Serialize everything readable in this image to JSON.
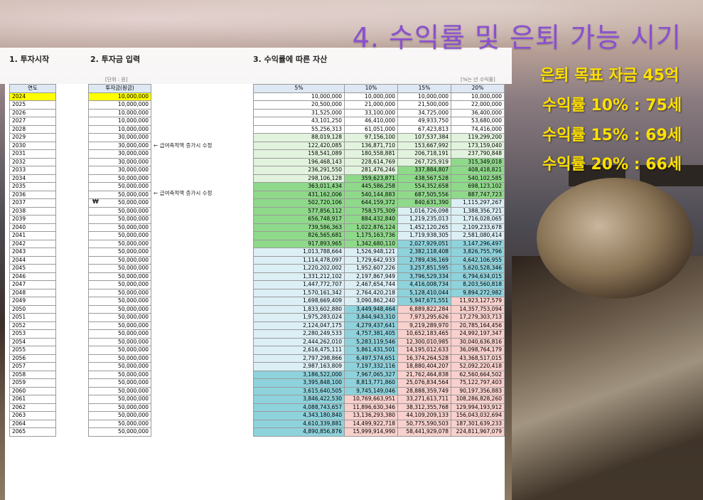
{
  "title": "4. 수익률 및 은퇴 가능 시기",
  "notes": [
    "은퇴 목표 자금 45억",
    "수익률 10% : 75세",
    "수익률 15% : 69세",
    "수익률 20% : 66세"
  ],
  "sections": {
    "s1": "1. 투자시작",
    "s2": "2. 투자금 입력",
    "s3": "3. 수익률에 따른 자산"
  },
  "unit_label": "[단위 : 원]",
  "rate_label": "[%는 년 수익률]",
  "headers": {
    "year": "연도",
    "invest": "투자금(원금)",
    "r5": "5%",
    "r10": "10%",
    "r15": "15%",
    "r20": "20%"
  },
  "memos": [
    "← 급여축적액 증가시 수정",
    "← 급여축적액 증가시 수정"
  ],
  "currency_symbol": "₩",
  "colors": {
    "title": "#8b4fd0",
    "notes": "#ffe000",
    "highlight_year": "#ffff00",
    "green_light": "#e2f3dd",
    "green_mid": "#c3e8b9",
    "green_dark": "#8fd98a",
    "blue_light": "#dceff5",
    "blue_mid": "#b5e0ea",
    "blue_dark": "#8ed2dc",
    "pink": "#f8d0cc"
  },
  "rows": [
    [
      "2024",
      "10,000,000",
      "10,000,000",
      "10,000,000",
      "10,000,000",
      "10,000,000"
    ],
    [
      "2025",
      "10,000,000",
      "20,500,000",
      "21,000,000",
      "21,500,000",
      "22,000,000"
    ],
    [
      "2026",
      "10,000,000",
      "31,525,000",
      "33,100,000",
      "34,725,000",
      "36,400,000"
    ],
    [
      "2027",
      "10,000,000",
      "43,101,250",
      "46,410,000",
      "49,933,750",
      "53,680,000"
    ],
    [
      "2028",
      "10,000,000",
      "55,256,313",
      "61,051,000",
      "67,423,813",
      "74,416,000"
    ],
    [
      "2029",
      "30,000,000",
      "88,019,128",
      "97,156,100",
      "107,537,384",
      "119,299,200"
    ],
    [
      "2030",
      "30,000,000",
      "122,420,085",
      "136,871,710",
      "153,667,992",
      "173,159,040"
    ],
    [
      "2031",
      "30,000,000",
      "158,541,089",
      "180,558,881",
      "206,718,191",
      "237,790,848"
    ],
    [
      "2032",
      "30,000,000",
      "196,468,143",
      "228,614,769",
      "267,725,919",
      "315,349,018"
    ],
    [
      "2033",
      "30,000,000",
      "236,291,550",
      "281,476,246",
      "337,884,807",
      "408,418,821"
    ],
    [
      "2034",
      "50,000,000",
      "298,106,128",
      "359,623,871",
      "438,567,528",
      "540,102,585"
    ],
    [
      "2035",
      "50,000,000",
      "363,011,434",
      "445,586,258",
      "554,352,658",
      "698,123,102"
    ],
    [
      "2036",
      "50,000,000",
      "431,162,006",
      "540,144,883",
      "687,505,556",
      "887,747,723"
    ],
    [
      "2037",
      "50,000,000",
      "502,720,106",
      "644,159,372",
      "840,631,390",
      "1,115,297,267"
    ],
    [
      "2038",
      "50,000,000",
      "577,856,112",
      "758,575,309",
      "1,016,726,098",
      "1,388,356,721"
    ],
    [
      "2039",
      "50,000,000",
      "656,748,917",
      "884,432,840",
      "1,219,235,013",
      "1,716,028,065"
    ],
    [
      "2040",
      "50,000,000",
      "739,586,363",
      "1,022,876,124",
      "1,452,120,265",
      "2,109,233,678"
    ],
    [
      "2041",
      "50,000,000",
      "826,565,681",
      "1,175,163,736",
      "1,719,938,305",
      "2,581,080,414"
    ],
    [
      "2042",
      "50,000,000",
      "917,893,965",
      "1,342,680,110",
      "2,027,929,051",
      "3,147,296,497"
    ],
    [
      "2043",
      "50,000,000",
      "1,013,788,664",
      "1,526,948,121",
      "2,382,118,408",
      "3,826,755,796"
    ],
    [
      "2044",
      "50,000,000",
      "1,114,478,097",
      "1,729,642,933",
      "2,789,436,169",
      "4,642,106,955"
    ],
    [
      "2045",
      "50,000,000",
      "1,220,202,002",
      "1,952,607,226",
      "3,257,851,595",
      "5,620,528,346"
    ],
    [
      "2046",
      "50,000,000",
      "1,331,212,102",
      "2,197,867,949",
      "3,796,529,334",
      "6,794,634,015"
    ],
    [
      "2047",
      "50,000,000",
      "1,447,772,707",
      "2,467,654,744",
      "4,416,008,734",
      "8,203,560,818"
    ],
    [
      "2048",
      "50,000,000",
      "1,570,161,342",
      "2,764,420,218",
      "5,128,410,044",
      "9,894,272,982"
    ],
    [
      "2049",
      "50,000,000",
      "1,698,669,409",
      "3,090,862,240",
      "5,947,671,551",
      "11,923,127,579"
    ],
    [
      "2050",
      "50,000,000",
      "1,833,602,880",
      "3,449,948,464",
      "6,889,822,284",
      "14,357,753,094"
    ],
    [
      "2051",
      "50,000,000",
      "1,975,283,024",
      "3,844,943,310",
      "7,973,295,626",
      "17,279,303,713"
    ],
    [
      "2052",
      "50,000,000",
      "2,124,047,175",
      "4,279,437,641",
      "9,219,289,970",
      "20,785,164,456"
    ],
    [
      "2053",
      "50,000,000",
      "2,280,249,533",
      "4,757,381,405",
      "10,652,183,465",
      "24,992,197,347"
    ],
    [
      "2054",
      "50,000,000",
      "2,444,262,010",
      "5,283,119,546",
      "12,300,010,985",
      "30,040,636,816"
    ],
    [
      "2055",
      "50,000,000",
      "2,616,475,111",
      "5,861,431,501",
      "14,195,012,633",
      "36,098,764,179"
    ],
    [
      "2056",
      "50,000,000",
      "2,797,298,866",
      "6,497,574,651",
      "16,374,264,528",
      "43,368,517,015"
    ],
    [
      "2057",
      "50,000,000",
      "2,987,163,809",
      "7,197,332,116",
      "18,880,404,207",
      "52,092,220,418"
    ],
    [
      "2058",
      "50,000,000",
      "3,186,522,000",
      "7,967,065,327",
      "21,762,464,838",
      "62,560,664,502"
    ],
    [
      "2059",
      "50,000,000",
      "3,395,848,100",
      "8,813,771,860",
      "25,076,834,564",
      "75,122,797,403"
    ],
    [
      "2060",
      "50,000,000",
      "3,615,640,505",
      "9,745,149,046",
      "28,888,359,749",
      "90,197,356,883"
    ],
    [
      "2061",
      "50,000,000",
      "3,846,422,530",
      "10,769,663,951",
      "33,271,613,711",
      "108,286,828,260"
    ],
    [
      "2062",
      "50,000,000",
      "4,088,743,657",
      "11,896,630,346",
      "38,312,355,768",
      "129,994,193,912"
    ],
    [
      "2063",
      "50,000,000",
      "4,343,180,840",
      "13,136,293,380",
      "44,109,209,133",
      "156,043,032,694"
    ],
    [
      "2064",
      "50,000,000",
      "4,610,339,881",
      "14,499,922,718",
      "50,775,590,503",
      "187,301,639,233"
    ],
    [
      "2065",
      "50,000,000",
      "4,890,856,876",
      "15,999,914,990",
      "58,441,929,078",
      "224,811,967,079"
    ]
  ]
}
